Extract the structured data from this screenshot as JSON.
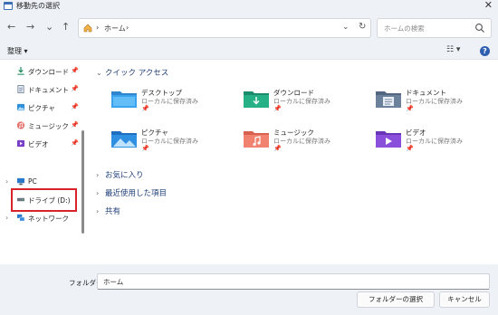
{
  "window": {
    "title": "移動先の選択",
    "close_glyph": "✕"
  },
  "nav": {
    "back": "←",
    "forward": "→",
    "recent": "⌄",
    "up": "↑",
    "breadcrumb": [
      "ホーム"
    ],
    "separator": "›",
    "dropdown": "⌄",
    "refresh": "↻",
    "search_placeholder": "ホームの検索"
  },
  "toolbar": {
    "organize_label": "整理 ▾",
    "view_glyph": "☷ ▾",
    "help_glyph": "?"
  },
  "sidebar": {
    "quick_items": [
      {
        "label": "ダウンロード",
        "icon": "download-icon",
        "pinned": true
      },
      {
        "label": "ドキュメント",
        "icon": "documents-icon",
        "pinned": true
      },
      {
        "label": "ピクチャ",
        "icon": "pictures-icon",
        "pinned": true
      },
      {
        "label": "ミュージック",
        "icon": "music-icon",
        "pinned": true
      },
      {
        "label": "ビデオ",
        "icon": "videos-icon",
        "pinned": true
      }
    ],
    "tree_items": [
      {
        "label": "PC",
        "icon": "pc-icon",
        "expandable": true
      },
      {
        "label": "ドライブ (D:)",
        "icon": "drive-icon",
        "expandable": false,
        "highlighted": true
      },
      {
        "label": "ネットワーク",
        "icon": "network-icon",
        "expandable": true
      }
    ],
    "pin_glyph": "📌",
    "chevron": "›"
  },
  "content": {
    "quick_access_header": "クイック アクセス",
    "tile_subtitle": "ローカルに保存済み",
    "tiles": [
      {
        "name": "デスクトップ",
        "icon": "desktop-folder-icon"
      },
      {
        "name": "ダウンロード",
        "icon": "downloads-folder-icon"
      },
      {
        "name": "ドキュメント",
        "icon": "documents-folder-icon"
      },
      {
        "name": "ピクチャ",
        "icon": "pictures-folder-icon"
      },
      {
        "name": "ミュージック",
        "icon": "music-folder-icon"
      },
      {
        "name": "ビデオ",
        "icon": "videos-folder-icon"
      }
    ],
    "collapsed_sections": [
      "お気に入り",
      "最近使用した項目",
      "共有"
    ]
  },
  "footer": {
    "folder_label": "フォルダー:",
    "folder_value": "ホーム",
    "select_button": "フォルダーの選択",
    "cancel_button": "キャンセル"
  },
  "colors": {
    "highlight": "#d8232a",
    "accent": "#2f5fb0"
  }
}
